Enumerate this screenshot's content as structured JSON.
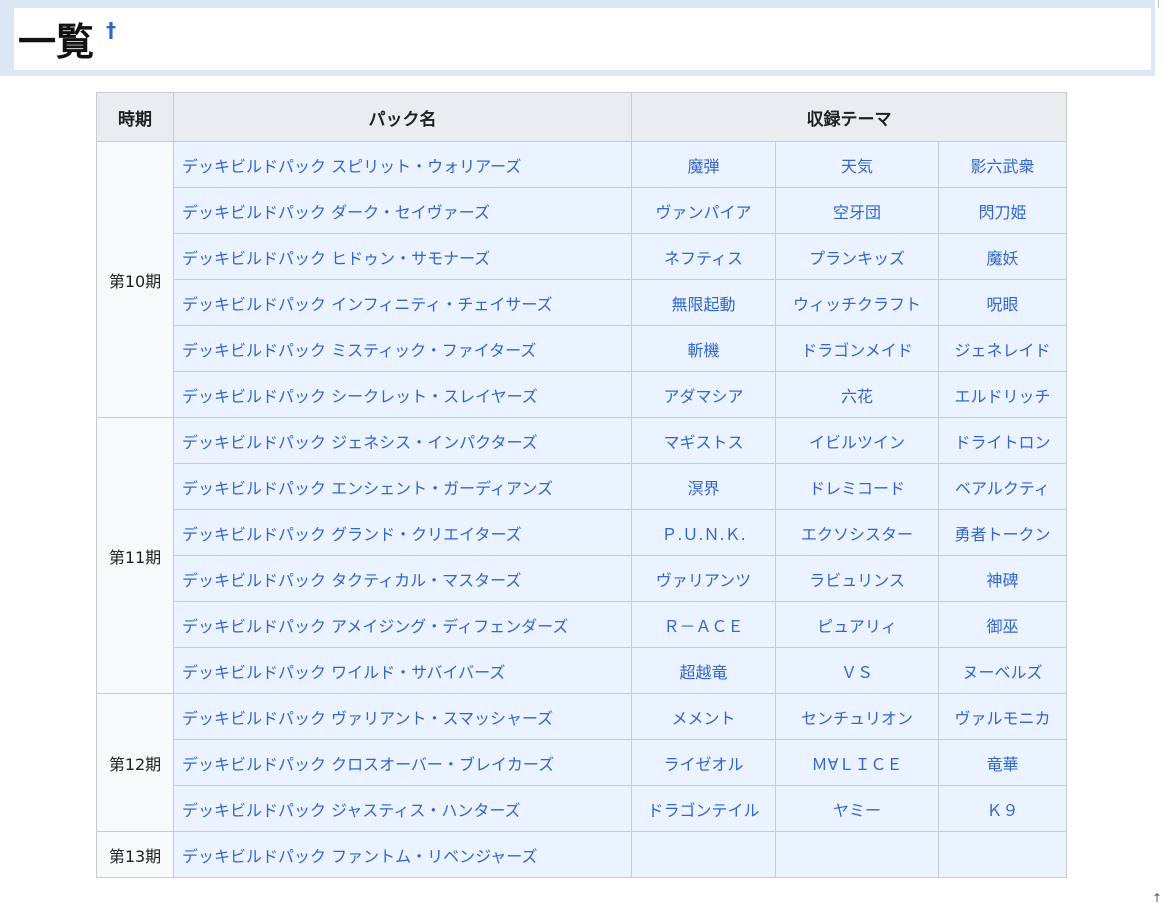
{
  "heading": {
    "title": "一覧",
    "edit_mark": "†"
  },
  "footer_mark": "↑",
  "table": {
    "headers": {
      "period": "時期",
      "pack": "パック名",
      "themes": "収録テーマ"
    },
    "groups": [
      {
        "period": "第10期",
        "rows": [
          {
            "pack": "デッキビルドパック スピリット・ウォリアーズ",
            "themes": [
              "魔弾",
              "天気",
              "影六武衆"
            ]
          },
          {
            "pack": "デッキビルドパック ダーク・セイヴァーズ",
            "themes": [
              "ヴァンパイア",
              "空牙団",
              "閃刀姫"
            ]
          },
          {
            "pack": "デッキビルドパック ヒドゥン・サモナーズ",
            "themes": [
              "ネフティス",
              "プランキッズ",
              "魔妖"
            ]
          },
          {
            "pack": "デッキビルドパック インフィニティ・チェイサーズ",
            "themes": [
              "無限起動",
              "ウィッチクラフト",
              "呪眼"
            ]
          },
          {
            "pack": "デッキビルドパック ミスティック・ファイターズ",
            "themes": [
              "斬機",
              "ドラゴンメイド",
              "ジェネレイド"
            ]
          },
          {
            "pack": "デッキビルドパック シークレット・スレイヤーズ",
            "themes": [
              "アダマシア",
              "六花",
              "エルドリッチ"
            ]
          }
        ]
      },
      {
        "period": "第11期",
        "rows": [
          {
            "pack": "デッキビルドパック ジェネシス・インパクターズ",
            "themes": [
              "マギストス",
              "イビルツイン",
              "ドライトロン"
            ]
          },
          {
            "pack": "デッキビルドパック エンシェント・ガーディアンズ",
            "themes": [
              "溟界",
              "ドレミコード",
              "ベアルクティ"
            ]
          },
          {
            "pack": "デッキビルドパック グランド・クリエイターズ",
            "themes": [
              "Ｐ.Ｕ.Ｎ.Ｋ.",
              "エクソシスター",
              "勇者トークン"
            ]
          },
          {
            "pack": "デッキビルドパック タクティカル・マスターズ",
            "themes": [
              "ヴァリアンツ",
              "ラビュリンス",
              "神碑"
            ]
          },
          {
            "pack": "デッキビルドパック アメイジング・ディフェンダーズ",
            "themes": [
              "Ｒ－ＡＣＥ",
              "ピュアリィ",
              "御巫"
            ]
          },
          {
            "pack": "デッキビルドパック ワイルド・サバイバーズ",
            "themes": [
              "超越竜",
              "ＶＳ",
              "ヌーベルズ"
            ]
          }
        ]
      },
      {
        "period": "第12期",
        "rows": [
          {
            "pack": "デッキビルドパック ヴァリアント・スマッシャーズ",
            "themes": [
              "メメント",
              "センチュリオン",
              "ヴァルモニカ"
            ]
          },
          {
            "pack": "デッキビルドパック クロスオーバー・ブレイカーズ",
            "themes": [
              "ライゼオル",
              "Ｍ∀ＬＩＣＥ",
              "竜華"
            ]
          },
          {
            "pack": "デッキビルドパック ジャスティス・ハンターズ",
            "themes": [
              "ドラゴンテイル",
              "ヤミー",
              "Ｋ９"
            ]
          }
        ]
      },
      {
        "period": "第13期",
        "rows": [
          {
            "pack": "デッキビルドパック ファントム・リベンジャーズ",
            "themes": [
              "",
              "",
              ""
            ]
          }
        ]
      }
    ]
  }
}
